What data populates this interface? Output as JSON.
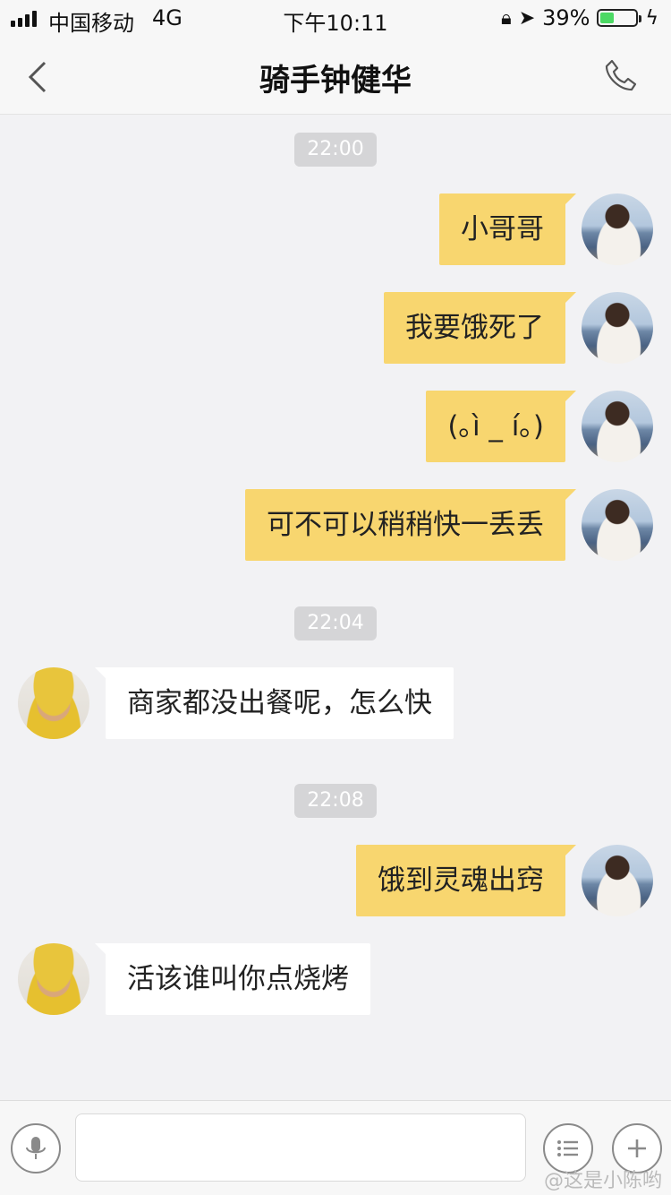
{
  "status_bar": {
    "carrier": "中国移动",
    "network": "4G",
    "time": "下午10:11",
    "battery_percent": "39%",
    "battery_level": 0.39
  },
  "nav": {
    "title": "骑手钟健华"
  },
  "timestamps": [
    "22:00",
    "22:04",
    "22:08"
  ],
  "messages": [
    {
      "sender": "me",
      "text": "小哥哥"
    },
    {
      "sender": "me",
      "text": "我要饿死了"
    },
    {
      "sender": "me",
      "text": "(｡ì _ í｡)"
    },
    {
      "sender": "me",
      "text": "可不可以稍稍快一丢丢"
    },
    {
      "sender": "rider",
      "text": "商家都没出餐呢，怎么快"
    },
    {
      "sender": "me",
      "text": "饿到灵魂出窍"
    },
    {
      "sender": "rider",
      "text": "活该谁叫你点烧烤"
    }
  ],
  "input": {
    "value": "",
    "placeholder": ""
  },
  "watermark": "@这是小陈哟"
}
